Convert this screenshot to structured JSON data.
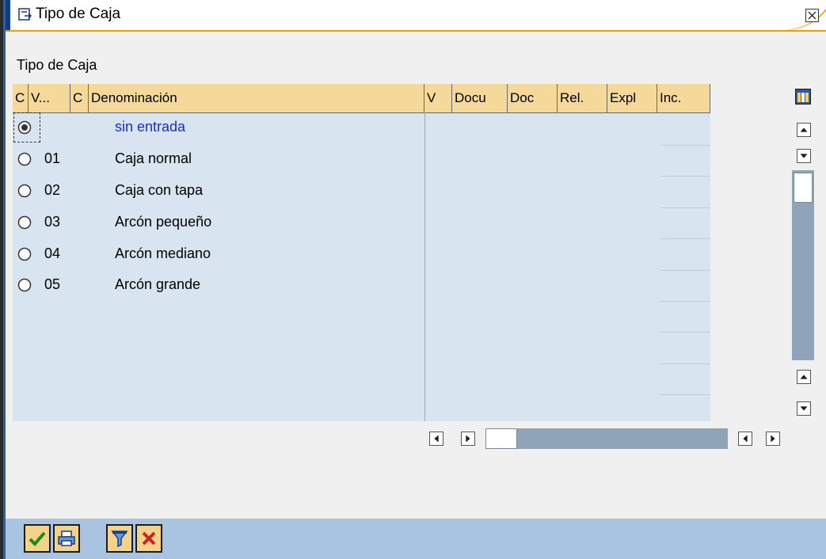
{
  "window": {
    "title": "Tipo de Caja"
  },
  "group": {
    "label": "Tipo de Caja"
  },
  "table": {
    "columns": [
      "C",
      "V...",
      "C",
      "Denominación",
      "V",
      "Docu",
      "Doc",
      "Rel.",
      "Expl",
      "Inc."
    ],
    "rows": [
      {
        "code": "",
        "den": "sin entrada",
        "selected": true
      },
      {
        "code": "01",
        "den": "Caja normal",
        "selected": false
      },
      {
        "code": "02",
        "den": "Caja con tapa",
        "selected": false
      },
      {
        "code": "03",
        "den": "Arcón pequeño",
        "selected": false
      },
      {
        "code": "04",
        "den": "Arcón mediano",
        "selected": false
      },
      {
        "code": "05",
        "den": "Arcón grande",
        "selected": false
      }
    ]
  },
  "toolbar": {
    "buttons": [
      "check-icon",
      "print-icon",
      "filter-icon",
      "cancel-icon"
    ]
  },
  "colors": {
    "header_bg": "#f5d99a",
    "table_bg": "#d8e4f0",
    "selected_text": "#1c2ccc",
    "title_accent": "#0b3f8b",
    "bottom_bar": "#a8c4e0"
  }
}
